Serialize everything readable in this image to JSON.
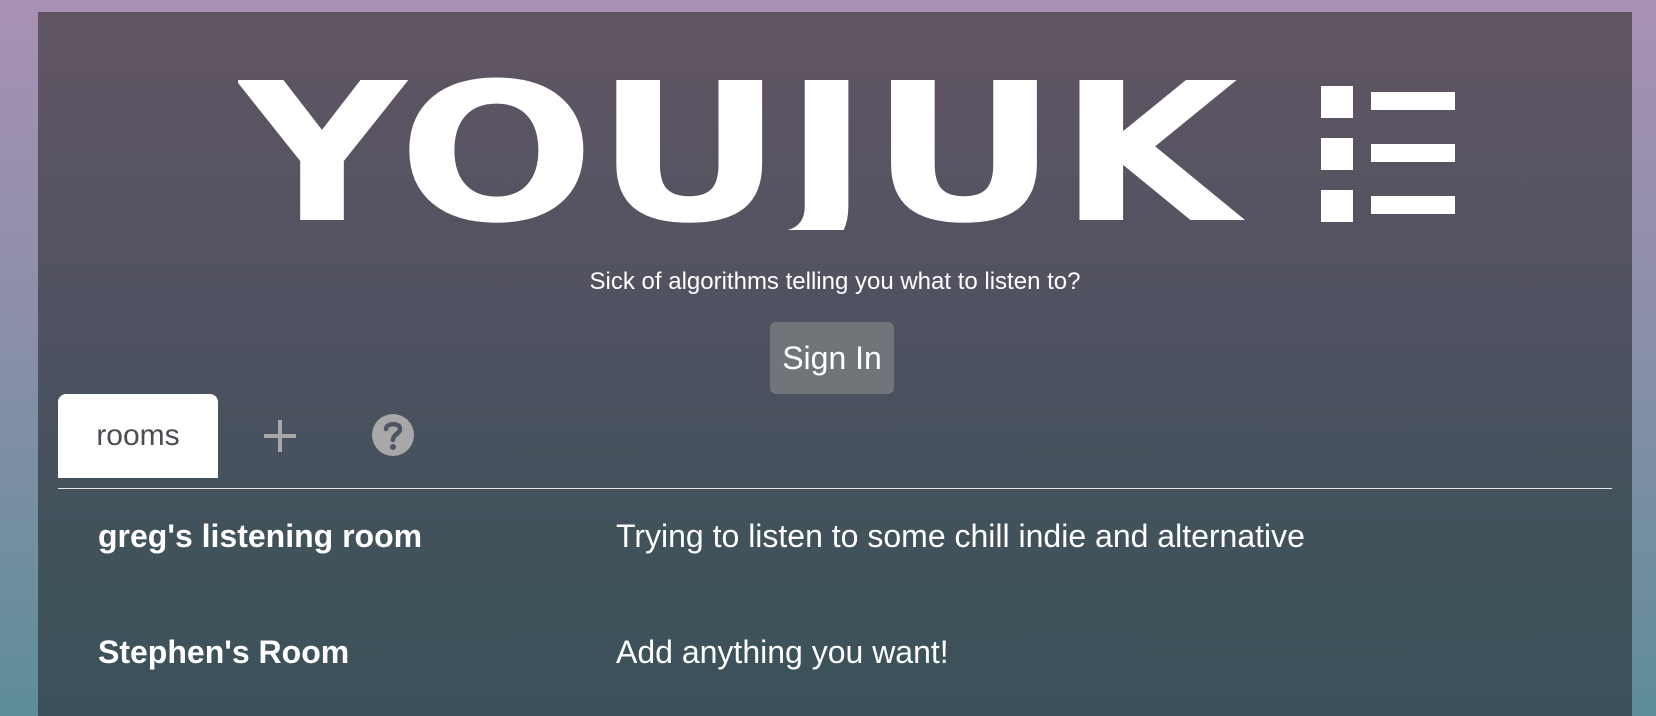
{
  "app": {
    "logo_text": "YOUJUK",
    "logo_suffix_icon": "menu-e-icon",
    "tagline": "Sick of algorithms telling you what to listen to?",
    "sign_in_label": "Sign In"
  },
  "tabs": {
    "rooms_label": "rooms",
    "add_icon": "plus-icon",
    "help_icon": "question-circle-icon"
  },
  "rooms": [
    {
      "name": "greg's listening room",
      "description": "Trying to listen to some chill indie and alternative"
    },
    {
      "name": "Stephen's Room",
      "description": "Add anything you want!"
    }
  ],
  "colors": {
    "page_bg_top": "#a891b3",
    "page_bg_bottom": "#5e8d99",
    "panel_top": "#615562",
    "panel_bottom": "#3b5159",
    "button_bg": "#6f7579",
    "tab_bg": "#ffffff"
  }
}
